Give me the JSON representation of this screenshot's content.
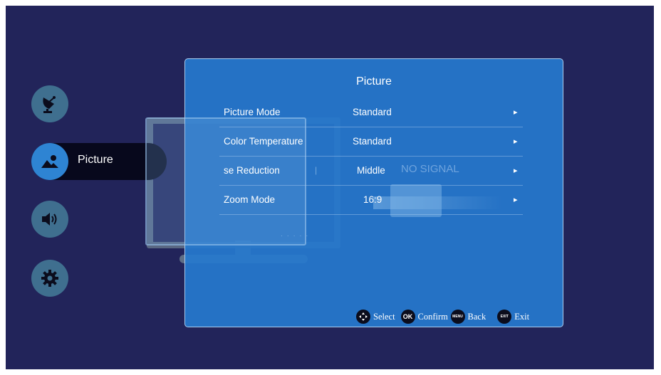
{
  "sidebar": {
    "items": [
      {
        "name": "satellite",
        "icon": "satellite-dish-icon"
      },
      {
        "name": "picture",
        "icon": "picture-icon",
        "label": "Picture",
        "active": true
      },
      {
        "name": "sound",
        "icon": "speaker-icon"
      },
      {
        "name": "settings",
        "icon": "gear-icon"
      }
    ]
  },
  "background": {
    "no_signal": "NO SIGNAL",
    "ghost_dots": "· · · · ·"
  },
  "panel": {
    "title": "Picture",
    "rows": [
      {
        "label": "Picture Mode",
        "value": "Standard",
        "arrow": "▸"
      },
      {
        "label": "Color Temperature",
        "value": "Standard",
        "arrow": "▸"
      },
      {
        "label": "se Reduction",
        "value": "Middle",
        "arrow": "▸"
      },
      {
        "label": "Zoom Mode",
        "value": "16:9",
        "arrow": "▸"
      }
    ]
  },
  "footer": {
    "select_label": "Select",
    "confirm_icon": "OK",
    "confirm_label": "Confirm",
    "back_icon": "MENU",
    "back_label": "Back",
    "exit_icon": "EXIT",
    "exit_label": "Exit"
  },
  "colors": {
    "screen_bg": "#22245a",
    "panel_bg": "#2678cd",
    "active_icon": "#2e84d3",
    "inactive_icon": "#3f6f8f"
  }
}
